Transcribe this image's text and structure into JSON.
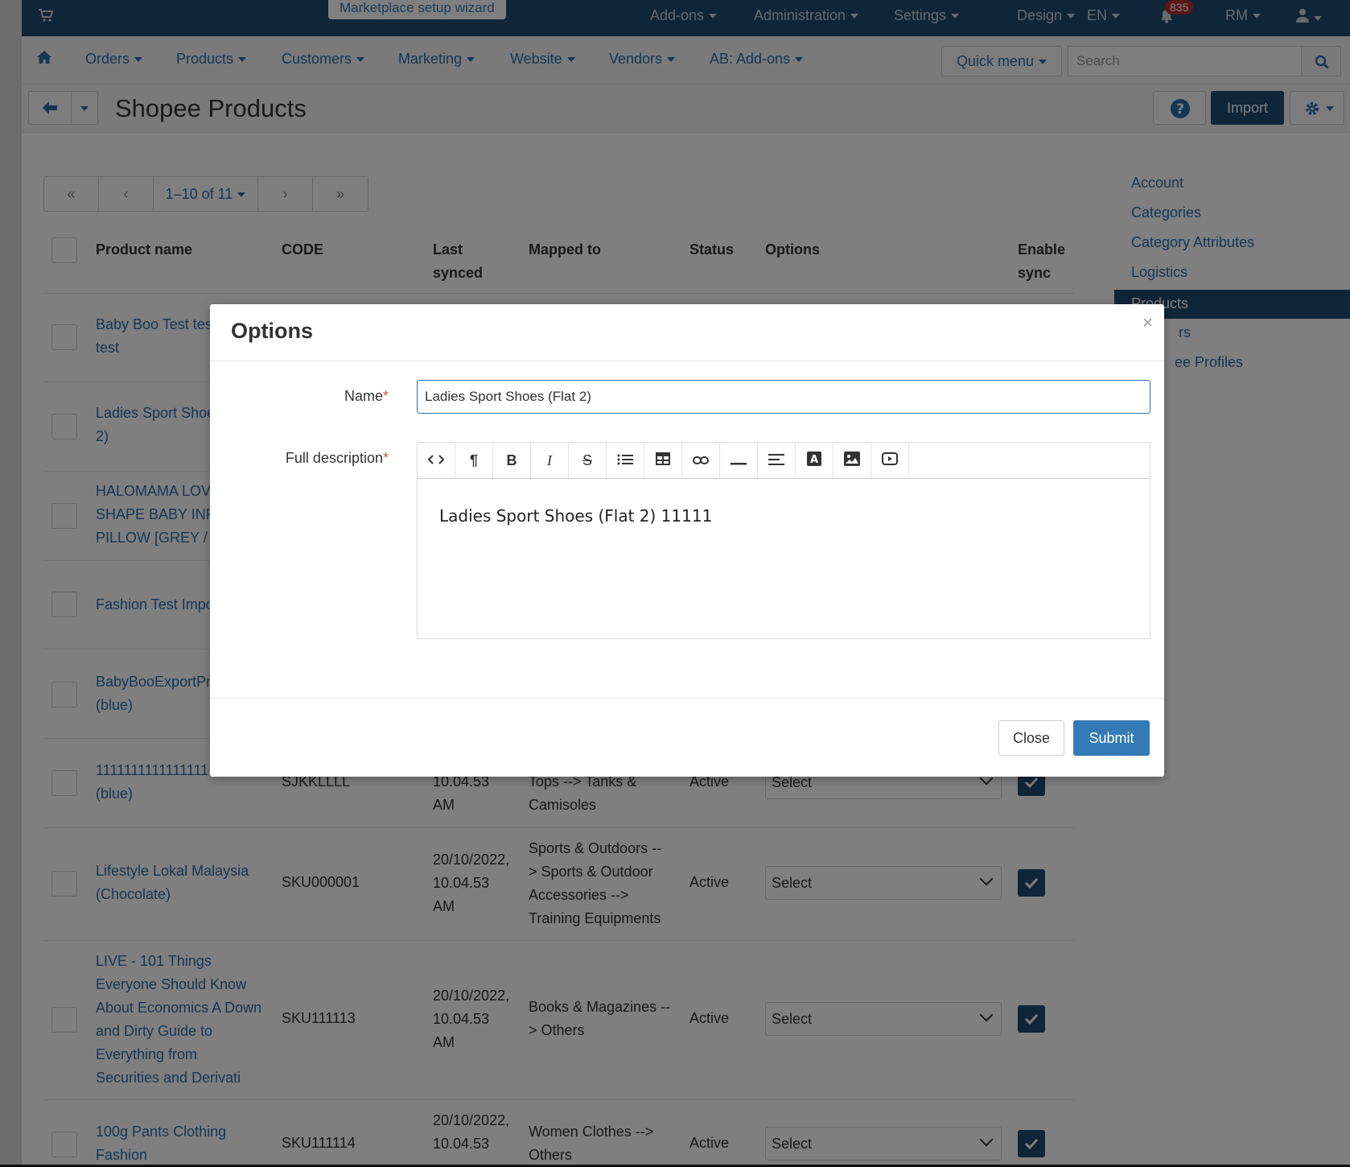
{
  "topbar": {
    "wizard": "Marketplace setup wizard",
    "menus": [
      "Add-ons",
      "Administration",
      "Settings",
      "Design",
      "EN"
    ],
    "notif_count": "835",
    "currency": "RM"
  },
  "subnav": {
    "items": [
      "Orders",
      "Products",
      "Customers",
      "Marketing",
      "Website",
      "Vendors",
      "AB: Add-ons"
    ],
    "quick_menu": "Quick menu",
    "search_placeholder": "Search"
  },
  "titlebar": {
    "title": "Shopee Products",
    "import": "Import"
  },
  "pager": {
    "first": "«",
    "prev": "‹",
    "label": "1–10 of 11",
    "next": "›",
    "last": "»"
  },
  "table": {
    "headers": {
      "name": "Product name",
      "code": "CODE",
      "last_synced_1": "Last",
      "last_synced_2": "synced",
      "mapped": "Mapped to",
      "status": "Status",
      "options": "Options",
      "sync_1": "Enable",
      "sync_2": "sync"
    },
    "rows": [
      {
        "name": [
          "Baby Boo Test tes",
          "test"
        ]
      },
      {
        "name": [
          "Ladies Sport Shoe",
          "2)"
        ]
      },
      {
        "name": [
          "HALOMAMA LOVE",
          "SHAPE BABY INFA",
          "PILLOW [GREY / P"
        ]
      },
      {
        "name": [
          "Fashion Test Impo"
        ]
      },
      {
        "name": [
          "BabyBooExportPr",
          "(blue)"
        ]
      },
      {
        "name": [
          "1111111111111111",
          "(blue)"
        ],
        "code": "SJKKLLLL",
        "synced": [
          "10.04.53",
          "AM"
        ],
        "mapped": [
          "Tops --> Tanks &",
          "Camisoles"
        ],
        "status": "Active",
        "option": "Select"
      },
      {
        "name": [
          "Lifestyle Lokal Malaysia",
          "(Chocolate)"
        ],
        "code": "SKU000001",
        "synced": [
          "20/10/2022,",
          "10.04.53",
          "AM"
        ],
        "mapped": [
          "Sports & Outdoors --",
          "> Sports & Outdoor",
          "Accessories -->",
          "Training Equipments"
        ],
        "status": "Active",
        "option": "Select"
      },
      {
        "name": [
          "LIVE - 101 Things",
          "Everyone Should Know",
          "About Economics A Down",
          "and Dirty Guide to",
          "Everything from",
          "Securities and Derivati"
        ],
        "code": "SKU111113",
        "synced": [
          "20/10/2022,",
          "10.04.53",
          "AM"
        ],
        "mapped": [
          "Books & Magazines --",
          "> Others"
        ],
        "status": "Active",
        "option": "Select"
      },
      {
        "name": [
          "100g Pants Clothing",
          "Fashion"
        ],
        "code": "SKU111114",
        "synced": [
          "20/10/2022,",
          "10.04.53"
        ],
        "mapped": [
          "Women Clothes -->",
          "Others"
        ],
        "status": "Active",
        "option": "Select"
      }
    ]
  },
  "sidebar": {
    "items": [
      "Account",
      "Categories",
      "Category Attributes",
      "Logistics",
      "Products",
      "rs",
      "ee Profiles"
    ]
  },
  "modal": {
    "title": "Options",
    "close_x": "×",
    "name_label": "Name",
    "name_value": "Ladies Sport Shoes (Flat 2)",
    "desc_label": "Full description",
    "required_mark": "*",
    "editor_text": "Ladies Sport Shoes (Flat 2) 11111",
    "toolbar": [
      "code-view-icon",
      "paragraph-icon",
      "bold-icon",
      "italic-icon",
      "strikethrough-icon",
      "bullet-list-icon",
      "table-icon",
      "link-icon",
      "horizontal-rule-icon",
      "align-icon",
      "font-color-icon",
      "image-icon",
      "video-icon"
    ],
    "close_btn": "Close",
    "submit_btn": "Submit"
  }
}
